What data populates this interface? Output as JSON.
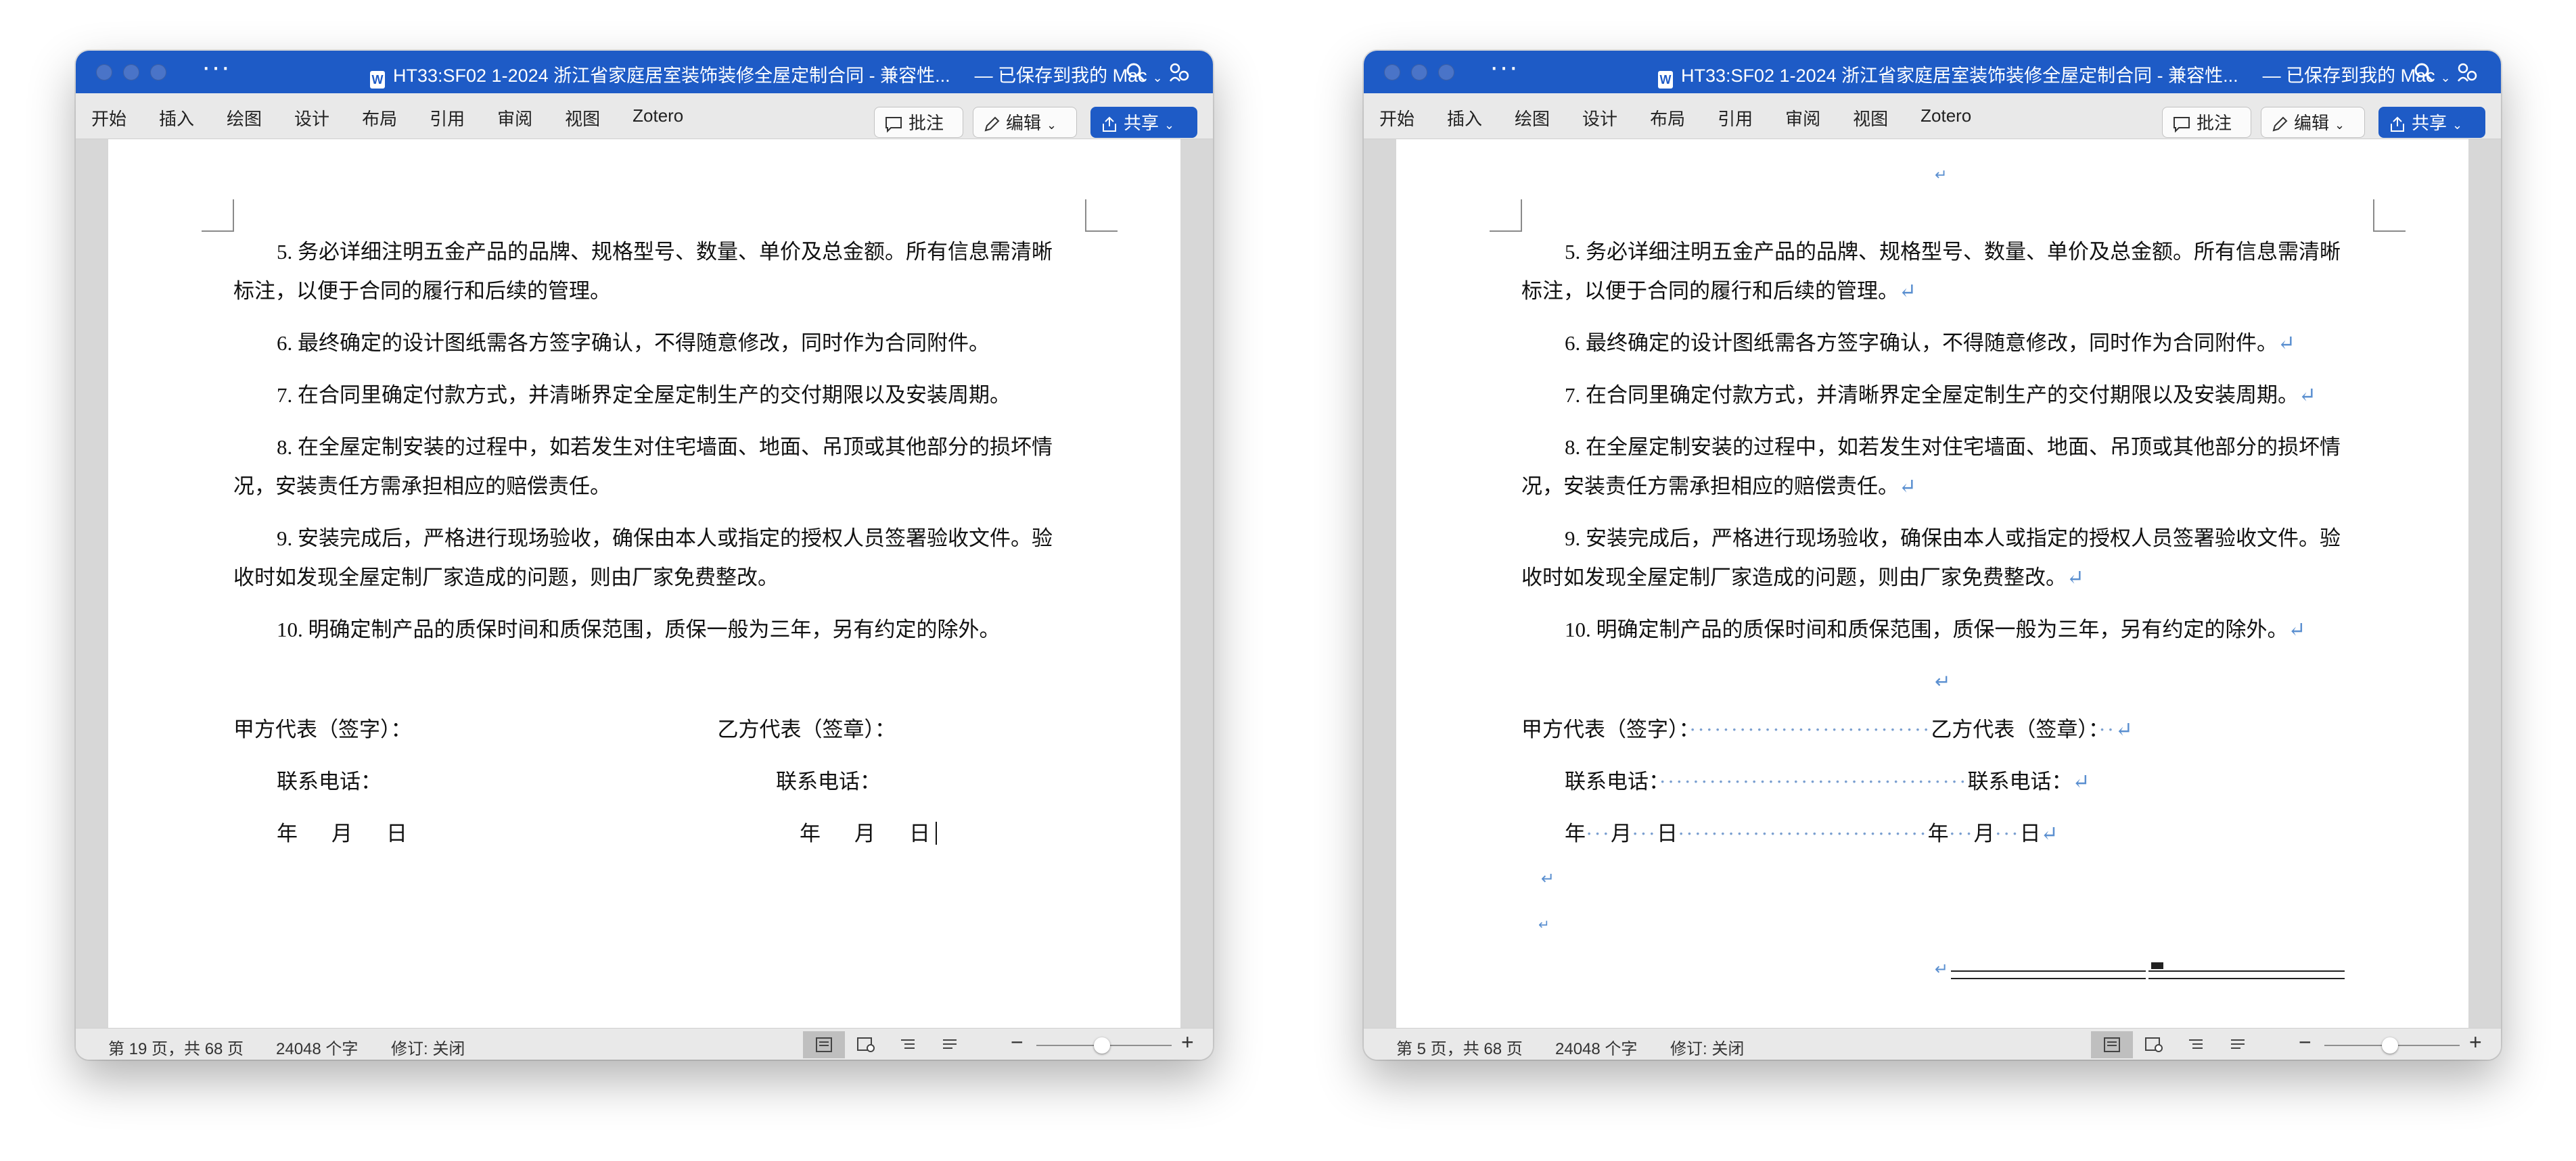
{
  "windows": [
    {
      "title": "HT33:SF02 1-2024 浙江省家庭居室装饰装修全屋定制合同 - 兼容性...",
      "saved_status": "— 已保存到我的 Mac",
      "tabs": [
        "开始",
        "插入",
        "绘图",
        "设计",
        "布局",
        "引用",
        "审阅",
        "视图",
        "Zotero"
      ],
      "buttons": {
        "comment": "批注",
        "edit": "编辑",
        "share": "共享"
      },
      "paragraphs": [
        "5. 务必详细注明五金产品的品牌、规格型号、数量、单价及总金额。所有信息需清晰标注，以便于合同的履行和后续的管理。",
        "6. 最终确定的设计图纸需各方签字确认，不得随意修改，同时作为合同附件。",
        "7. 在合同里确定付款方式，并清晰界定全屋定制生产的交付期限以及安装周期。",
        "8. 在全屋定制安装的过程中，如若发生对住宅墙面、地面、吊顶或其他部分的损坏情况，安装责任方需承担相应的赔偿责任。",
        "9. 安装完成后，严格进行现场验收，确保由本人或指定的授权人员签署验收文件。验收时如发现全屋定制厂家造成的问题，则由厂家免费整改。",
        "10. 明确定制产品的质保时间和质保范围，质保一般为三年，另有约定的除外。"
      ],
      "signature": {
        "party_a": "甲方代表（签字）：",
        "party_b": "乙方代表（签章）：",
        "phone": "联系电话：",
        "year": "年",
        "month": "月",
        "day": "日"
      },
      "status": {
        "page": "第 19 页，共 68 页",
        "words": "24048 个字",
        "track": "修订: 关闭"
      },
      "zoom_level": 0.6
    },
    {
      "title": "HT33:SF02 1-2024 浙江省家庭居室装饰装修全屋定制合同 - 兼容性...",
      "saved_status": "— 已保存到我的 Mac",
      "tabs": [
        "开始",
        "插入",
        "绘图",
        "设计",
        "布局",
        "引用",
        "审阅",
        "视图",
        "Zotero"
      ],
      "buttons": {
        "comment": "批注",
        "edit": "编辑",
        "share": "共享"
      },
      "paragraphs": [
        "5. 务必详细注明五金产品的品牌、规格型号、数量、单价及总金额。所有信息需清晰标注，以便于合同的履行和后续的管理。",
        "6. 最终确定的设计图纸需各方签字确认，不得随意修改，同时作为合同附件。",
        "7. 在合同里确定付款方式，并清晰界定全屋定制生产的交付期限以及安装周期。",
        "8. 在全屋定制安装的过程中，如若发生对住宅墙面、地面、吊顶或其他部分的损坏情况，安装责任方需承担相应的赔偿责任。",
        "9. 安装完成后，严格进行现场验收，确保由本人或指定的授权人员签署验收文件。验收时如发现全屋定制厂家造成的问题，则由厂家免费整改。",
        "10. 明确定制产品的质保时间和质保范围，质保一般为三年，另有约定的除外。"
      ],
      "signature": {
        "party_a": "甲方代表（签字）：",
        "party_b": "乙方代表（签章）：",
        "phone": "联系电话：",
        "year": "年",
        "month": "月",
        "day": "日"
      },
      "paragraph_mark": "↵",
      "status": {
        "page": "第 5 页，共 68 页",
        "words": "24048 个字",
        "track": "修订: 关闭"
      },
      "zoom_level": 0.6
    }
  ],
  "colors": {
    "titlebar": "#1e5bc6",
    "paragraph_mark": "#5a8fd0"
  }
}
